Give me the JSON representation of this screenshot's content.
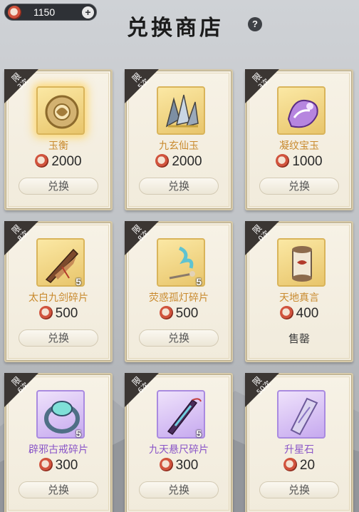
{
  "header": {
    "currency_amount": "1150",
    "plus_label": "+",
    "title": "兑换商店",
    "help_label": "?"
  },
  "items": [
    {
      "badge_top": "限",
      "badge_bottom": "3次",
      "name": "玉衡",
      "price": "2000",
      "action": "兑换",
      "rarity": "gold",
      "icon": "jade-disc-icon"
    },
    {
      "badge_top": "限",
      "badge_bottom": "5次",
      "name": "九玄仙玉",
      "price": "2000",
      "action": "兑换",
      "rarity": "gold",
      "icon": "crystal-shard-icon"
    },
    {
      "badge_top": "限",
      "badge_bottom": "3次",
      "name": "凝纹宝玉",
      "price": "1000",
      "action": "兑换",
      "rarity": "gold",
      "icon": "purple-gem-icon"
    },
    {
      "badge_top": "限",
      "badge_bottom": "8次",
      "name": "太白九剑碎片",
      "price": "500",
      "action": "兑换",
      "rarity": "gold",
      "icon": "sword-fragment-icon",
      "qty": "5"
    },
    {
      "badge_top": "限",
      "badge_bottom": "8次",
      "name": "荧惑孤灯碎片",
      "price": "500",
      "action": "兑换",
      "rarity": "gold",
      "icon": "lantern-fragment-icon",
      "qty": "5"
    },
    {
      "badge_top": "限",
      "badge_bottom": "0次",
      "name": "天地真言",
      "price": "400",
      "action": "售罄",
      "rarity": "gold",
      "icon": "scroll-icon",
      "sold_out": true
    },
    {
      "badge_top": "限",
      "badge_bottom": "6次",
      "name": "辟邪古戒碎片",
      "price": "300",
      "action": "兑换",
      "rarity": "purple",
      "icon": "ring-fragment-icon",
      "qty": "5"
    },
    {
      "badge_top": "限",
      "badge_bottom": "6次",
      "name": "九天悬尺碎片",
      "price": "300",
      "action": "兑换",
      "rarity": "purple",
      "icon": "ruler-fragment-icon",
      "qty": "5"
    },
    {
      "badge_top": "限",
      "badge_bottom": "50次",
      "name": "升星石",
      "price": "20",
      "action": "兑换",
      "rarity": "purple",
      "icon": "star-stone-icon"
    }
  ],
  "colors": {
    "gold_name": "#c98a2e",
    "purple_name": "#8a55c8",
    "badge_bg": "#3b3633"
  }
}
